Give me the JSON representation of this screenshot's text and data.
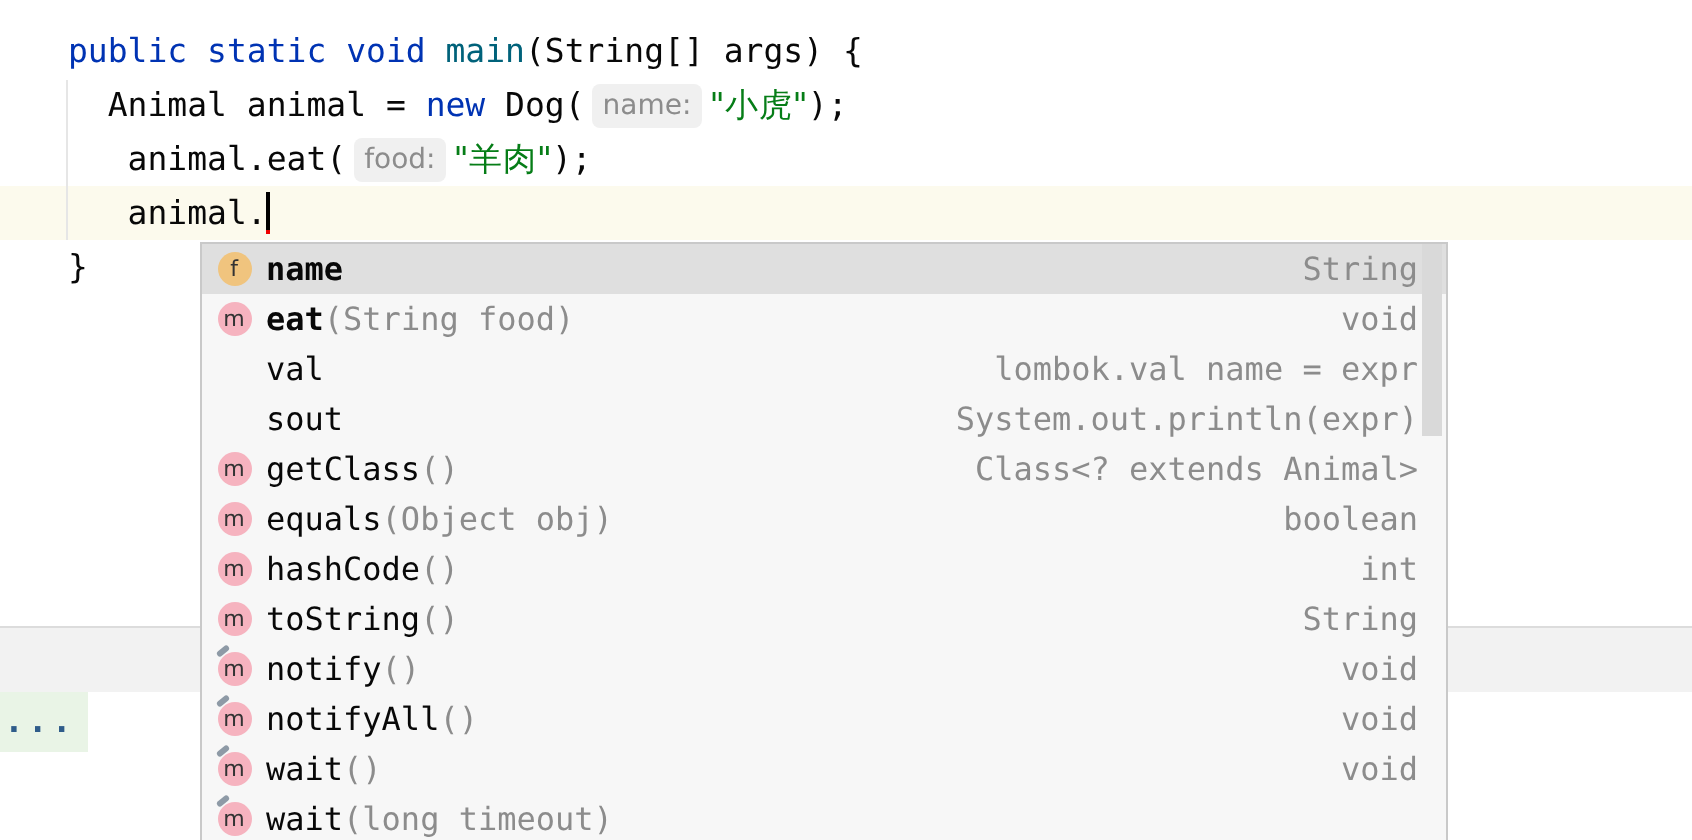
{
  "editor": {
    "lines": [
      {
        "current": false,
        "tokens": [
          {
            "kind": "keyword",
            "text": "public static void "
          },
          {
            "kind": "method",
            "text": "main"
          },
          {
            "kind": "plain",
            "text": "(String[] args) {"
          }
        ]
      },
      {
        "current": false,
        "tokens": [
          {
            "kind": "plain",
            "text": "  Animal animal = "
          },
          {
            "kind": "keyword",
            "text": "new"
          },
          {
            "kind": "plain",
            "text": " Dog("
          },
          {
            "kind": "hint",
            "text": "name:"
          },
          {
            "kind": "string",
            "text": "\"小虎\""
          },
          {
            "kind": "plain",
            "text": ");"
          }
        ]
      },
      {
        "current": false,
        "tokens": [
          {
            "kind": "plain",
            "text": "   animal.eat("
          },
          {
            "kind": "hint",
            "text": "food:"
          },
          {
            "kind": "string",
            "text": "\"羊肉\""
          },
          {
            "kind": "plain",
            "text": ");"
          }
        ]
      },
      {
        "current": true,
        "caret": true,
        "tokens": [
          {
            "kind": "plain",
            "text": "   animal."
          }
        ]
      },
      {
        "current": false,
        "tokens": [
          {
            "kind": "plain",
            "text": "}"
          }
        ]
      }
    ],
    "folded_marker": "..."
  },
  "completion": {
    "items": [
      {
        "kind": "field",
        "icon_text": "f",
        "name": "name",
        "type": "String",
        "bold": true,
        "selected": true
      },
      {
        "kind": "method",
        "icon_text": "m",
        "name": "eat",
        "params": "(String food)",
        "type": "void",
        "bold": true,
        "selected": false
      },
      {
        "kind": "template",
        "name": "val",
        "type": "lombok.val name = expr",
        "bold": false,
        "selected": false
      },
      {
        "kind": "template",
        "name": "sout",
        "type": "System.out.println(expr)",
        "bold": false,
        "selected": false
      },
      {
        "kind": "method",
        "icon_text": "m",
        "name": "getClass",
        "params": "()",
        "type": "Class<? extends Animal>",
        "bold": false,
        "selected": false
      },
      {
        "kind": "method",
        "icon_text": "m",
        "name": "equals",
        "params": "(Object obj)",
        "type": "boolean",
        "bold": false,
        "selected": false
      },
      {
        "kind": "method",
        "icon_text": "m",
        "name": "hashCode",
        "params": "()",
        "type": "int",
        "bold": false,
        "selected": false
      },
      {
        "kind": "method",
        "icon_text": "m",
        "name": "toString",
        "params": "()",
        "type": "String",
        "bold": false,
        "selected": false
      },
      {
        "kind": "final",
        "icon_text": "m",
        "name": "notify",
        "params": "()",
        "type": "void",
        "bold": false,
        "selected": false
      },
      {
        "kind": "final",
        "icon_text": "m",
        "name": "notifyAll",
        "params": "()",
        "type": "void",
        "bold": false,
        "selected": false
      },
      {
        "kind": "final",
        "icon_text": "m",
        "name": "wait",
        "params": "()",
        "type": "void",
        "bold": false,
        "selected": false
      },
      {
        "kind": "final",
        "icon_text": "m",
        "name": "wait",
        "params": "(long timeout)",
        "bold": false,
        "selected": false
      }
    ]
  }
}
